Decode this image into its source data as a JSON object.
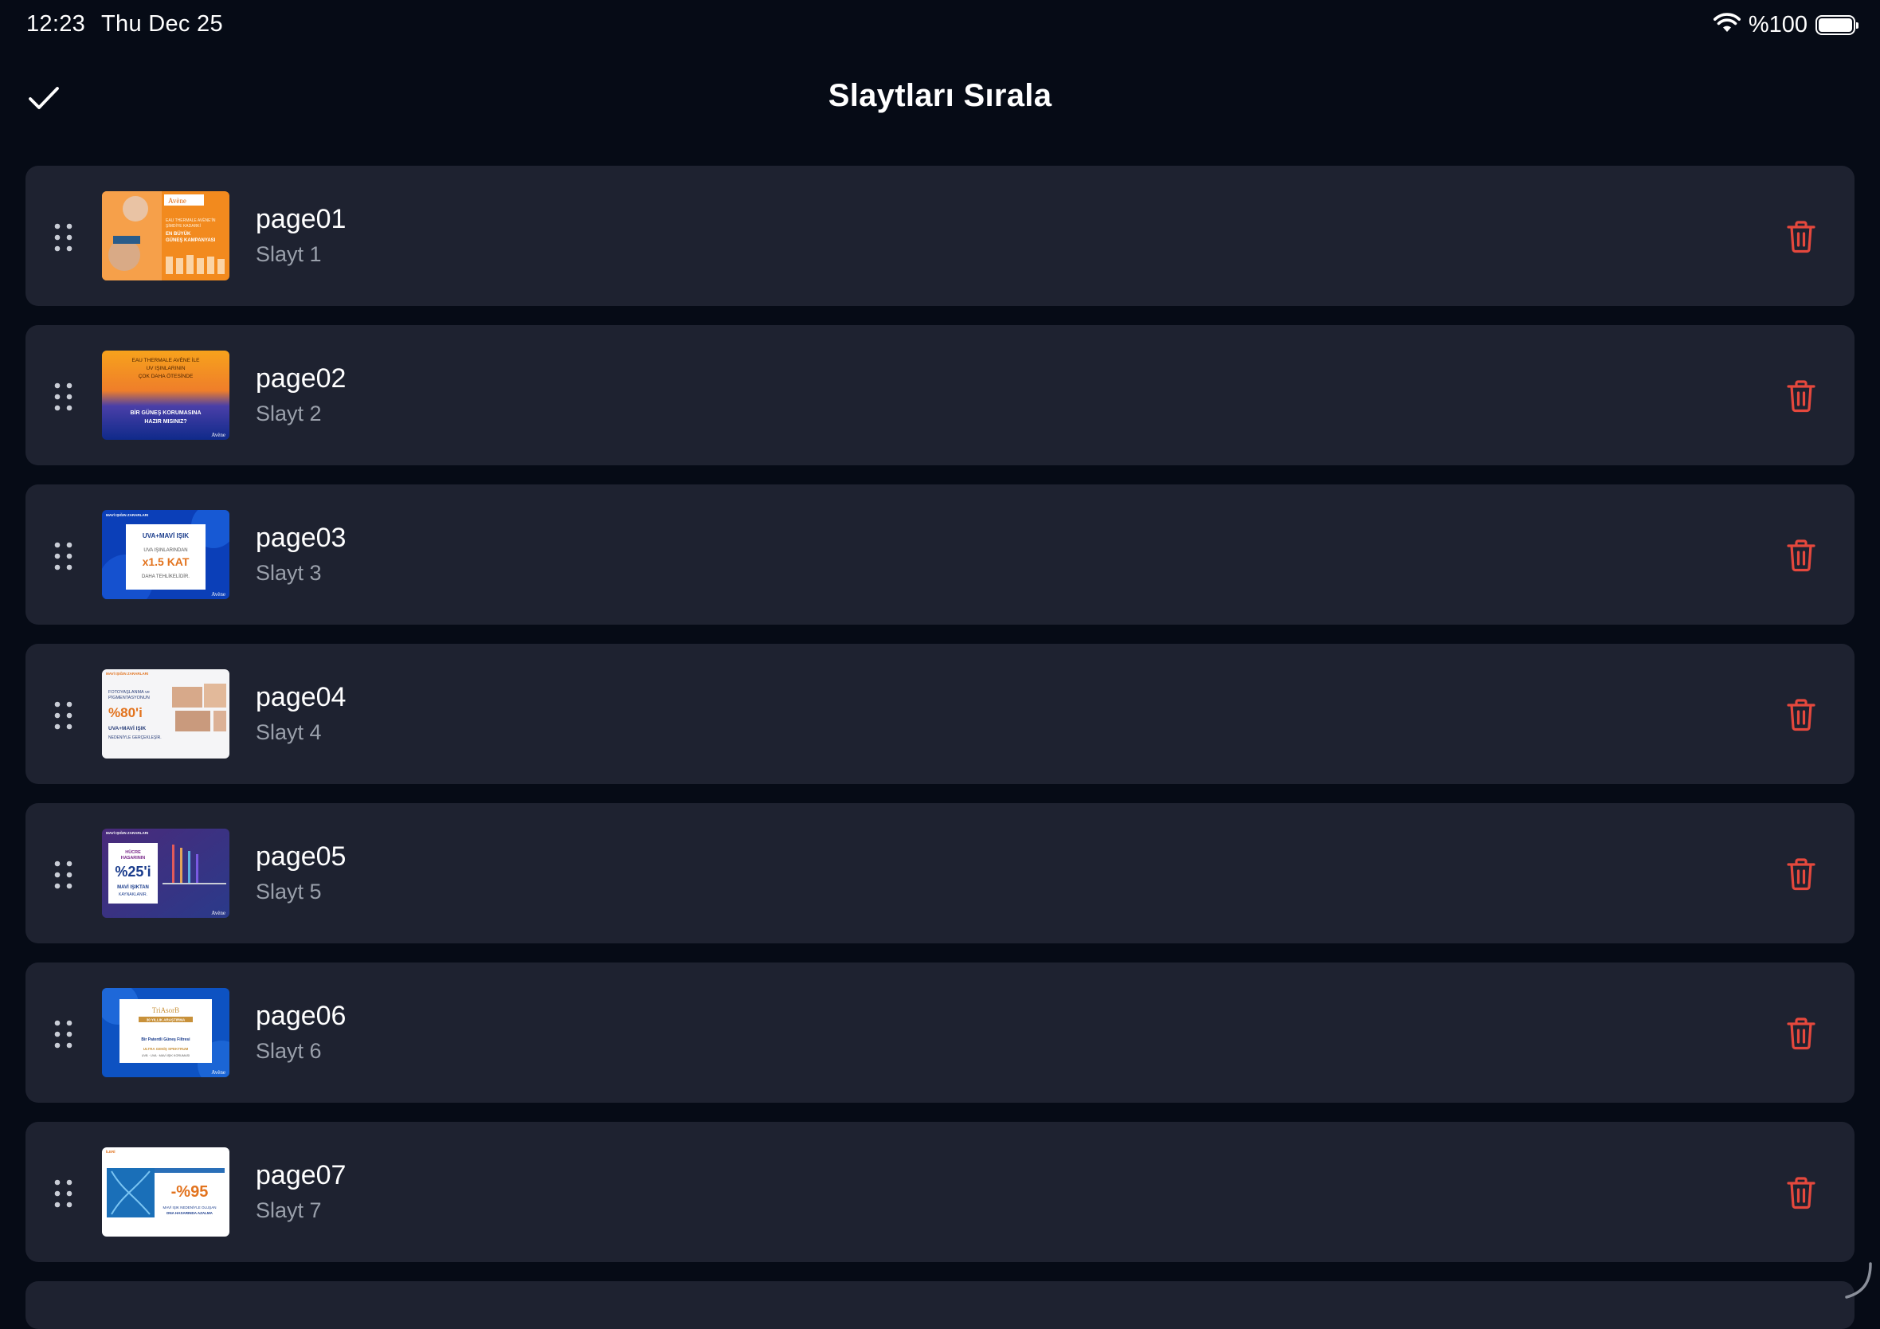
{
  "status": {
    "time": "12:23",
    "date": "Thu Dec 25",
    "battery": "%100",
    "battery_level": 1.0
  },
  "nav": {
    "title": "Slaytları Sırala",
    "done_icon": "checkmark-icon"
  },
  "colors": {
    "background": "#060b16",
    "row": "#1e2230",
    "delete": "#e5483d",
    "subtitle": "#9aa0ab"
  },
  "slides": [
    {
      "title": "page01",
      "subtitle": "Slayt 1"
    },
    {
      "title": "page02",
      "subtitle": "Slayt 2"
    },
    {
      "title": "page03",
      "subtitle": "Slayt 3"
    },
    {
      "title": "page04",
      "subtitle": "Slayt 4"
    },
    {
      "title": "page05",
      "subtitle": "Slayt 5"
    },
    {
      "title": "page06",
      "subtitle": "Slayt 6"
    },
    {
      "title": "page07",
      "subtitle": "Slayt 7"
    }
  ],
  "thumbs": {
    "t1": {
      "logo": "Avène",
      "l1": "EAU THERMALE AVÈNE'İN",
      "l2": "ŞİMDİYE KADARKİ",
      "l3": "EN BÜYÜK",
      "l4": "GÜNEŞ KAMPANYASI"
    },
    "t2": {
      "l1": "EAU THERMALE AVÈNE İLE",
      "l2": "UV IŞINLARININ",
      "l3": "ÇOK DAHA ÖTESİNDE",
      "l4": "BİR GÜNEŞ KORUMASINA",
      "l5": "HAZIR MISINIZ?",
      "logo": "Avène"
    },
    "t3": {
      "head": "MAVİ IŞIĞIN ZARARLARI",
      "l1": "UVA+MAVİ IŞIK",
      "l2": "UVA IŞINLARINDAN",
      "l3": "x1.5 KAT",
      "l4": "DAHA TEHLİKELİDİR.",
      "logo": "Avène"
    },
    "t4": {
      "head": "MAVİ IŞIĞIN ZARARLARI",
      "l1": "FOTOYAŞLANMA ve",
      "l2": "PİGMENTASYONUN",
      "l3": "%80'i",
      "l4": "UVA+MAVİ IŞIK",
      "l5": "NEDENİYLE GERÇEKLEŞİR."
    },
    "t5": {
      "head": "MAVİ IŞIĞIN ZARARLARI",
      "l1": "HÜCRE",
      "l2": "HASARININ",
      "l3": "%25'i",
      "l4": "MAVİ IŞIKTAN",
      "l5": "KAYNAKLANIR.",
      "logo": "Avène"
    },
    "t6": {
      "l1": "TriAsorB",
      "l2": "30 YILLIK ARAŞTIRMA",
      "l3": "Bir Patentli Güneş Filtresi",
      "l4": "ULTRA GENİŞ SPEKTRUM",
      "l5": "UVB · UVA · MAVİ IŞIK KORUMASI",
      "logo": "Avène"
    },
    "t7": {
      "head": "İLERİ",
      "l1": "-%95",
      "l2": "MAVİ IŞIK NEDENİYLE OLUŞAN",
      "l3": "DNA HASARINDA AZALMA"
    }
  }
}
